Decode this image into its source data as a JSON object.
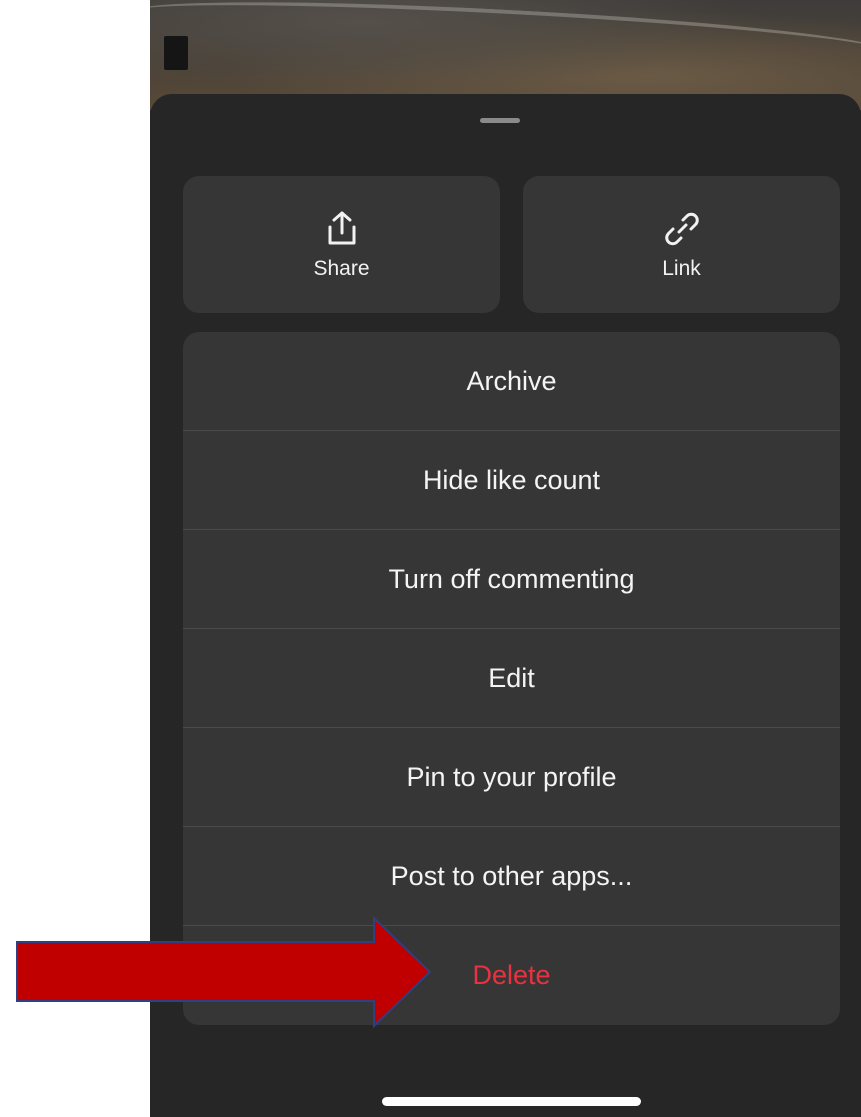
{
  "share_sheet": {
    "tiles": [
      {
        "label": "Share",
        "icon": "share-icon"
      },
      {
        "label": "Link",
        "icon": "link-icon"
      }
    ],
    "menu_items": [
      {
        "label": "Archive"
      },
      {
        "label": "Hide like count"
      },
      {
        "label": "Turn off commenting"
      },
      {
        "label": "Edit"
      },
      {
        "label": "Pin to your profile"
      },
      {
        "label": "Post to other apps..."
      },
      {
        "label": "Delete"
      }
    ]
  },
  "colors": {
    "sheet_background": "#262626",
    "item_background": "#363636",
    "destructive": "#e8323f",
    "annotation_arrow": "#c00000",
    "annotation_arrow_outline": "#2f3f7f"
  }
}
